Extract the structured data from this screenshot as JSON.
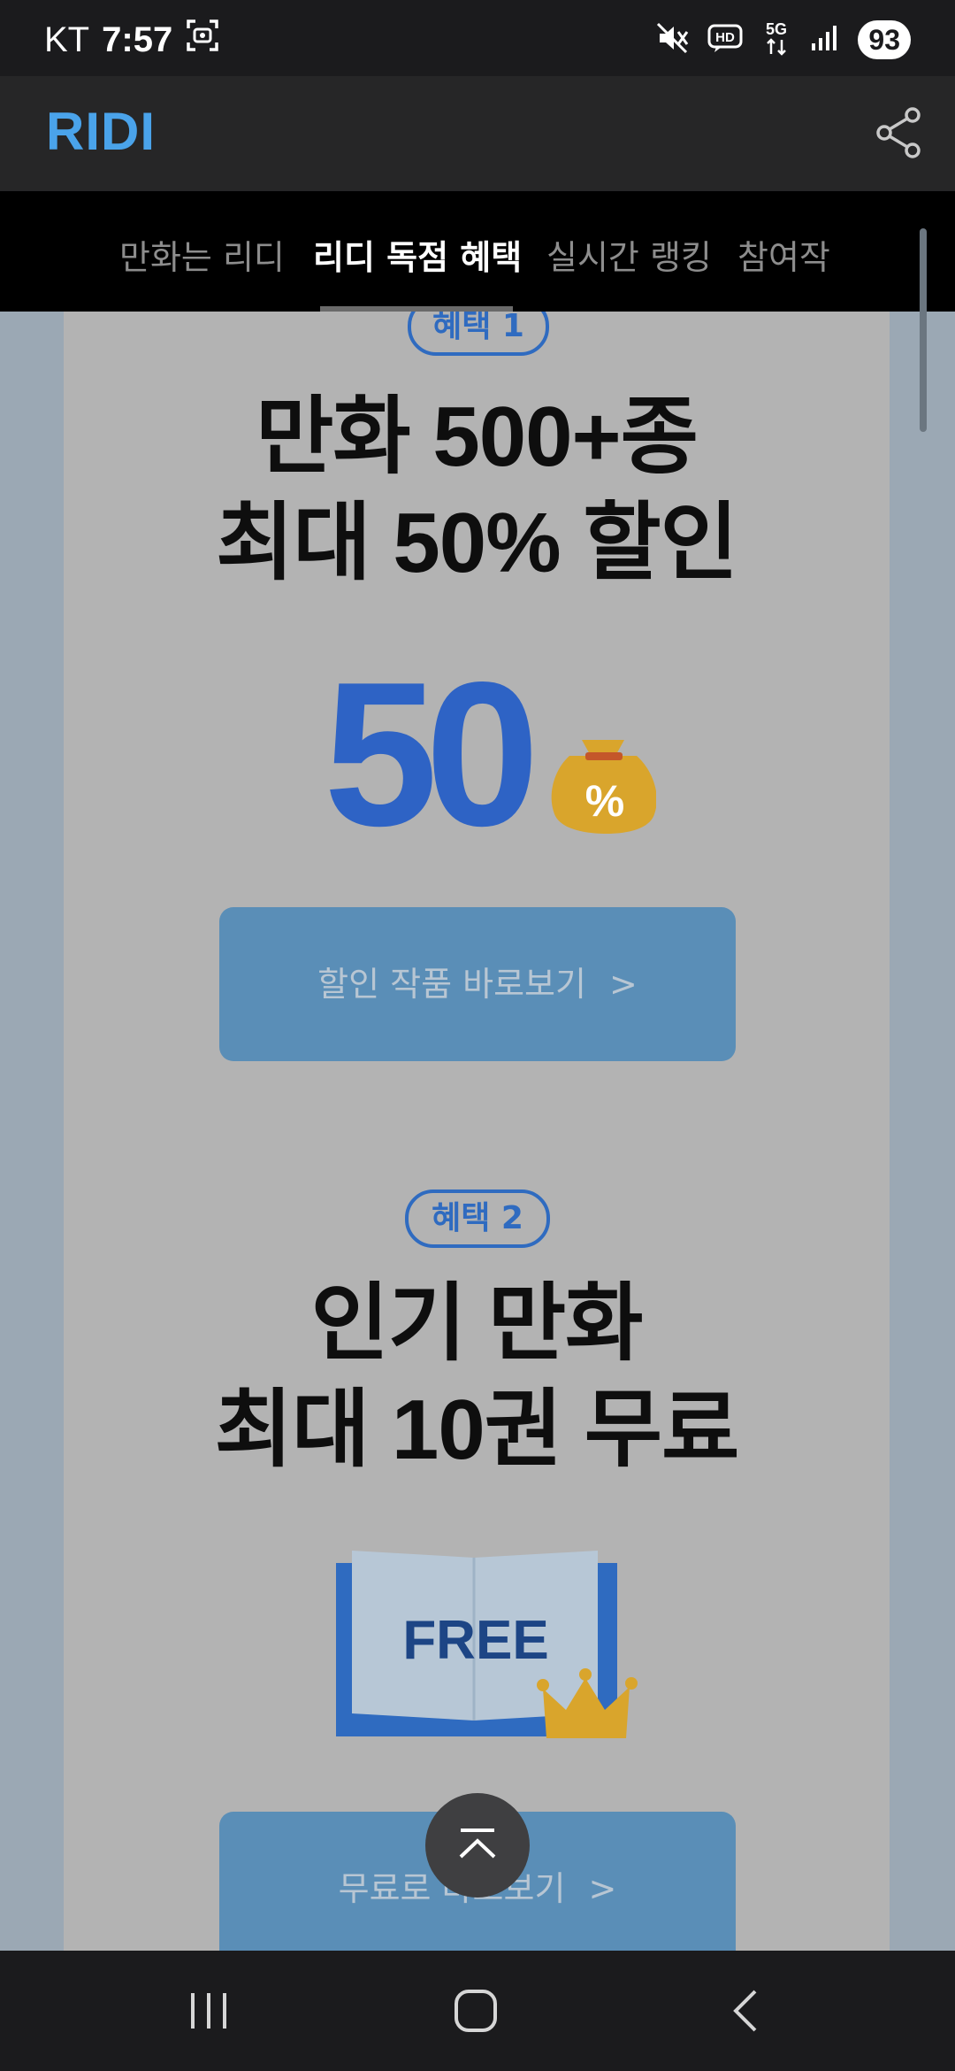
{
  "status_bar": {
    "carrier": "KT",
    "time": "7:57",
    "battery": "93",
    "network": "5G",
    "hd_label": "HD"
  },
  "header": {
    "logo": "RIDI",
    "logo_color": "#4aa3ea"
  },
  "tabs": [
    {
      "label": "만화는 리디",
      "active": false
    },
    {
      "label": "리디 독점 혜택",
      "active": true
    },
    {
      "label": "실시간 랭킹",
      "active": false
    },
    {
      "label": "참여작",
      "active": false
    }
  ],
  "benefits": [
    {
      "badge": "혜택 1",
      "title_line1": "만화 500+종",
      "title_line2": "최대 50% 할인",
      "graphic_text": "50",
      "graphic_badge": "%",
      "cta_label": "할인 작품 바로보기",
      "cta_chevron": ">"
    },
    {
      "badge": "혜택 2",
      "title_line1": "인기 만화",
      "title_line2": "최대 10권 무료",
      "graphic_text": "FREE",
      "cta_label": "무료로 바로보기",
      "cta_chevron": ">"
    }
  ],
  "colors": {
    "accent_blue": "#2f6bc0",
    "cta_bg": "#5a8eb7",
    "card_bg": "#b3b3b3",
    "gold": "#d9a52c"
  }
}
